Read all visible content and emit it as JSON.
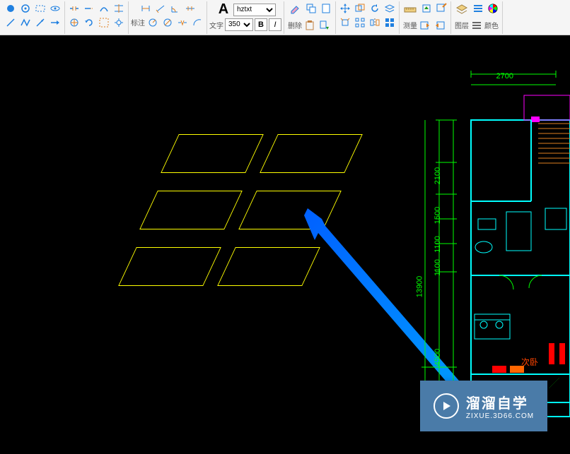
{
  "toolbar": {
    "annotation": {
      "label": "标注"
    },
    "text": {
      "label": "文字",
      "font": "hztxt",
      "size": "350",
      "bold": "B",
      "italic": "I"
    },
    "delete": {
      "label": "删除"
    },
    "measure": {
      "label": "测量"
    },
    "layer": {
      "label": "图层"
    },
    "color": {
      "label": "颜色"
    }
  },
  "icons": {
    "text_icon": "A"
  },
  "floorplan": {
    "dimensions": {
      "top_1": "2700",
      "left_1": "2100",
      "left_2": "1500",
      "left_3": "1100",
      "left_4": "1100",
      "left_5": "4500",
      "left_total": "13900"
    },
    "room_label": "次卧"
  },
  "watermark": {
    "title": "溜溜自学",
    "subtitle": "ZIXUE.3D66.COM"
  },
  "colors": {
    "canvas_bg": "#000000",
    "parallelogram": "#ffff00",
    "arrow": "#0080ff",
    "dimension": "#00ff00",
    "wall": "#00ffff",
    "tag_fill": "#ff0000",
    "watermark_bg": "#4a7ba8"
  }
}
